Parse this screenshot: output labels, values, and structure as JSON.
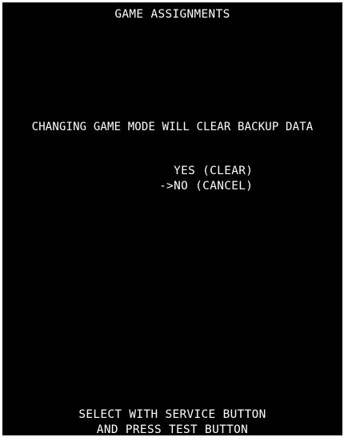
{
  "screen": {
    "title": "GAME ASSIGNMENTS",
    "warning": "CHANGING GAME MODE WILL CLEAR BACKUP DATA",
    "options": [
      {
        "label": "YES (CLEAR)",
        "selected": false
      },
      {
        "label": "NO (CANCEL)",
        "selected": true
      }
    ],
    "cursor": "->",
    "instructions": [
      "SELECT WITH SERVICE BUTTON",
      "AND PRESS TEST BUTTON"
    ]
  },
  "colors": {
    "background": "#000000",
    "text": "#ffffff"
  }
}
